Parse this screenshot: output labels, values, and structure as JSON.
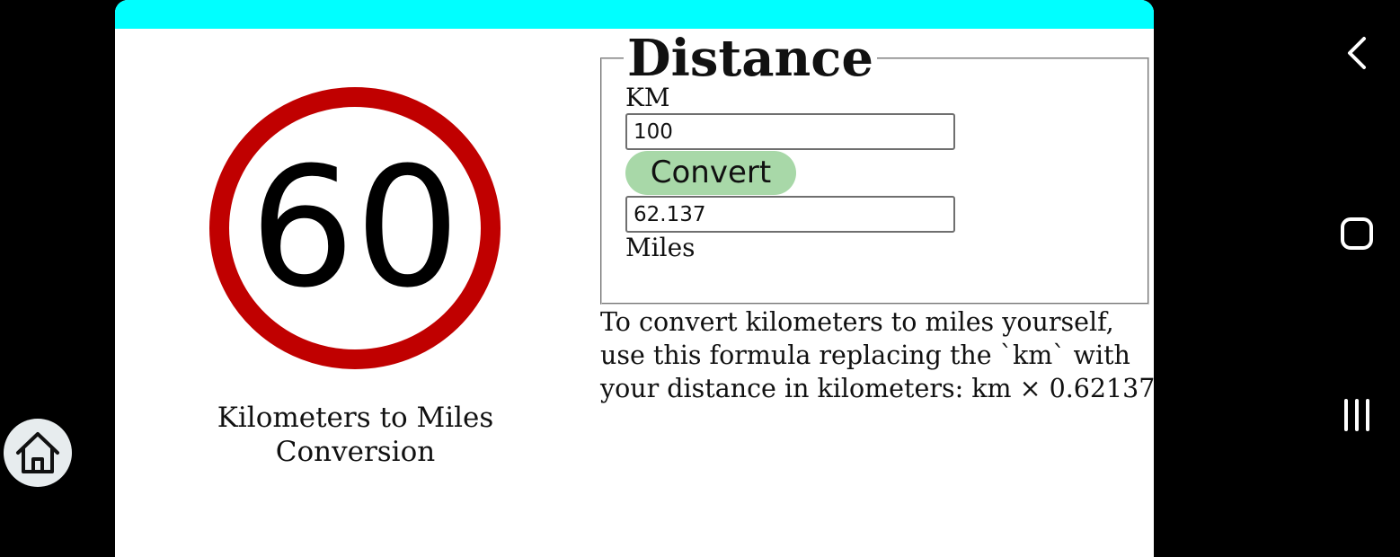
{
  "sign": {
    "speed_value": "60",
    "caption_line1": "Kilometers to Miles",
    "caption_line2": "Conversion"
  },
  "converter": {
    "legend": "Distance",
    "km_label": "KM",
    "km_value": "100",
    "convert_label": "Convert",
    "miles_value": "62.137",
    "miles_label": "Miles"
  },
  "formula": {
    "line1": "To convert kilometers to miles yourself,",
    "line2": "use this formula replacing the `km` with",
    "line3": "your distance in kilometers: km × 0.62137"
  },
  "colors": {
    "header": "#00ffff",
    "sign_ring": "#c00000",
    "convert_button": "#a8d8a8"
  },
  "icons": {
    "back": "chevron-left-icon",
    "home": "square-icon",
    "recents": "recents-icon",
    "home_fab": "house-icon"
  }
}
